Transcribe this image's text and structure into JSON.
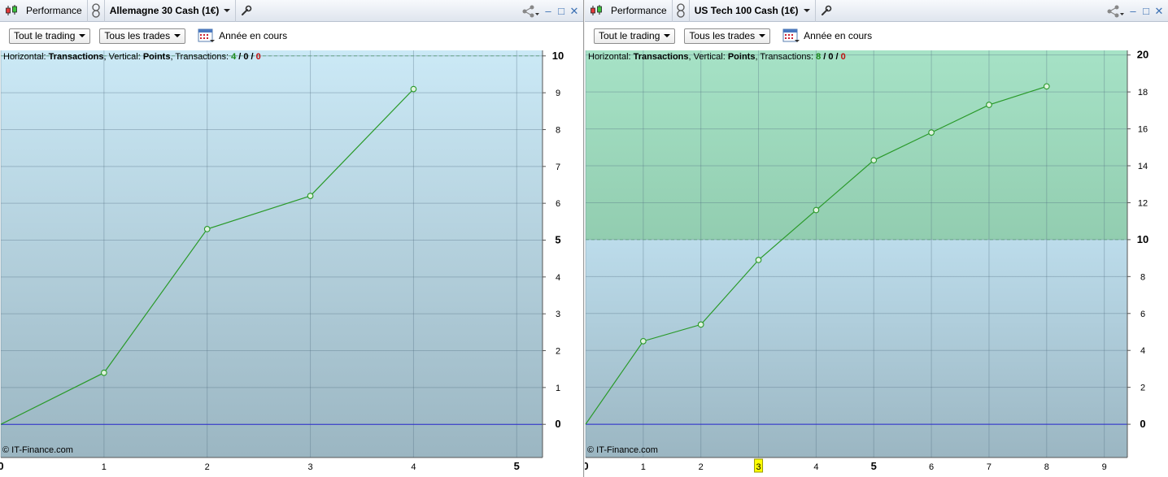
{
  "panels": [
    {
      "id": "left",
      "performance_label": "Performance",
      "instrument": "Allemagne 30 Cash (1€)",
      "filter_trading": "Tout le trading",
      "filter_trades": "Tous les trades",
      "period": "Année en cours",
      "info": {
        "horizontal_label": "Horizontal:",
        "horizontal_value": "Transactions",
        "vertical_label": "Vertical:",
        "vertical_value": "Points",
        "transactions_label": "Transactions:",
        "wins": "4",
        "neutral": "0",
        "losses": "0"
      },
      "copyright": "© IT-Finance.com",
      "colors": {
        "zone_top": "#cbe9f6",
        "zone_bottom": "#9bb6c2",
        "line": "#2a9a2a",
        "zero_line": "#2a2ad0"
      },
      "chart_data": {
        "type": "line",
        "x": [
          0,
          1,
          2,
          3,
          4
        ],
        "y": [
          0,
          1.4,
          5.3,
          6.2,
          9.1
        ],
        "xlim": [
          0,
          5.25
        ],
        "ylim": [
          -0.9,
          10.15
        ],
        "x_ticks": [
          "0",
          "1",
          "2",
          "3",
          "4",
          "5"
        ],
        "x_bold_ticks": [
          "0",
          "5"
        ],
        "y_ticks": [
          "0",
          "1",
          "2",
          "3",
          "4",
          "5",
          "6",
          "7",
          "8",
          "9",
          "10"
        ],
        "y_bold_ticks": [
          "0",
          "5",
          "10"
        ],
        "target": 10,
        "highlight_x": null,
        "grid": true
      }
    },
    {
      "id": "right",
      "performance_label": "Performance",
      "instrument": "US Tech 100 Cash (1€)",
      "filter_trading": "Tout le trading",
      "filter_trades": "Tous les trades",
      "period": "Année en cours",
      "info": {
        "horizontal_label": "Horizontal:",
        "horizontal_value": "Transactions",
        "vertical_label": "Vertical:",
        "vertical_value": "Points",
        "transactions_label": "Transactions:",
        "wins": "8",
        "neutral": "0",
        "losses": "0"
      },
      "copyright": "© IT-Finance.com",
      "colors": {
        "zone_top": "#a6e2c6",
        "zone_mid": "#92cdb0",
        "zone_low_top": "#bcdceb",
        "zone_bottom": "#9bb6c2",
        "line": "#2a9a2a",
        "zero_line": "#2a2ad0",
        "highlight": "#ffff00"
      },
      "chart_data": {
        "type": "line",
        "x": [
          0,
          1,
          2,
          3,
          4,
          5,
          6,
          7,
          8
        ],
        "y": [
          0,
          4.5,
          5.4,
          8.9,
          11.6,
          14.3,
          15.8,
          17.3,
          18.3
        ],
        "xlim": [
          0,
          9.4
        ],
        "ylim": [
          -1.8,
          20.25
        ],
        "x_ticks": [
          "0",
          "1",
          "2",
          "3",
          "4",
          "5",
          "6",
          "7",
          "8",
          "9"
        ],
        "x_bold_ticks": [
          "0",
          "5"
        ],
        "y_ticks": [
          "0",
          "2",
          "4",
          "6",
          "8",
          "10",
          "12",
          "14",
          "16",
          "18",
          "20"
        ],
        "y_bold_ticks": [
          "0",
          "10",
          "20"
        ],
        "target": 10,
        "highlight_x": "3",
        "grid": true
      }
    }
  ]
}
